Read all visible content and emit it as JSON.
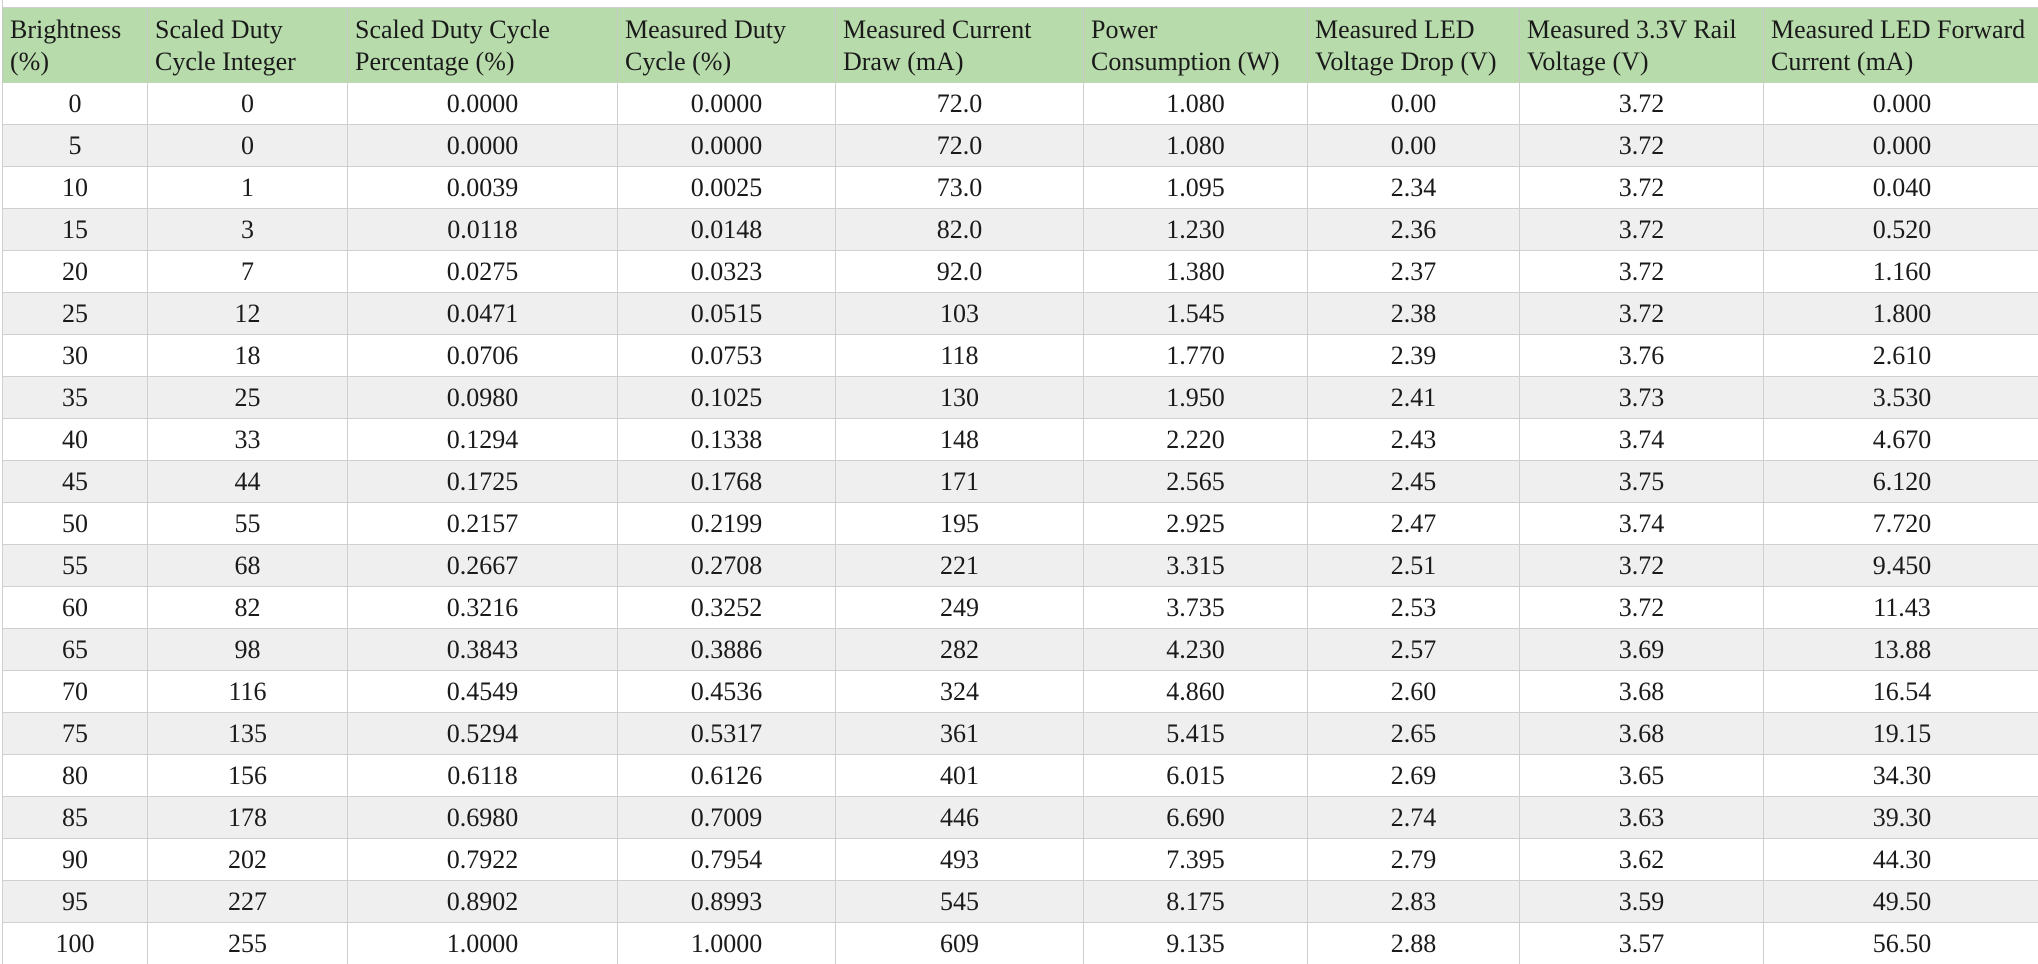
{
  "table": {
    "headers": [
      "Brightness (%)",
      "Scaled Duty Cycle Integer",
      "Scaled Duty Cycle Percentage (%)",
      "Measured Duty Cycle (%)",
      "Measured Current Draw (mA)",
      "Power Consumption (W)",
      "Measured LED Voltage Drop (V)",
      "Measured 3.3V Rail Voltage (V)",
      "Measured LED Forward Current (mA)"
    ],
    "rows": [
      [
        "0",
        "0",
        "0.0000",
        "0.0000",
        "72.0",
        "1.080",
        "0.00",
        "3.72",
        "0.000"
      ],
      [
        "5",
        "0",
        "0.0000",
        "0.0000",
        "72.0",
        "1.080",
        "0.00",
        "3.72",
        "0.000"
      ],
      [
        "10",
        "1",
        "0.0039",
        "0.0025",
        "73.0",
        "1.095",
        "2.34",
        "3.72",
        "0.040"
      ],
      [
        "15",
        "3",
        "0.0118",
        "0.0148",
        "82.0",
        "1.230",
        "2.36",
        "3.72",
        "0.520"
      ],
      [
        "20",
        "7",
        "0.0275",
        "0.0323",
        "92.0",
        "1.380",
        "2.37",
        "3.72",
        "1.160"
      ],
      [
        "25",
        "12",
        "0.0471",
        "0.0515",
        "103",
        "1.545",
        "2.38",
        "3.72",
        "1.800"
      ],
      [
        "30",
        "18",
        "0.0706",
        "0.0753",
        "118",
        "1.770",
        "2.39",
        "3.76",
        "2.610"
      ],
      [
        "35",
        "25",
        "0.0980",
        "0.1025",
        "130",
        "1.950",
        "2.41",
        "3.73",
        "3.530"
      ],
      [
        "40",
        "33",
        "0.1294",
        "0.1338",
        "148",
        "2.220",
        "2.43",
        "3.74",
        "4.670"
      ],
      [
        "45",
        "44",
        "0.1725",
        "0.1768",
        "171",
        "2.565",
        "2.45",
        "3.75",
        "6.120"
      ],
      [
        "50",
        "55",
        "0.2157",
        "0.2199",
        "195",
        "2.925",
        "2.47",
        "3.74",
        "7.720"
      ],
      [
        "55",
        "68",
        "0.2667",
        "0.2708",
        "221",
        "3.315",
        "2.51",
        "3.72",
        "9.450"
      ],
      [
        "60",
        "82",
        "0.3216",
        "0.3252",
        "249",
        "3.735",
        "2.53",
        "3.72",
        "11.43"
      ],
      [
        "65",
        "98",
        "0.3843",
        "0.3886",
        "282",
        "4.230",
        "2.57",
        "3.69",
        "13.88"
      ],
      [
        "70",
        "116",
        "0.4549",
        "0.4536",
        "324",
        "4.860",
        "2.60",
        "3.68",
        "16.54"
      ],
      [
        "75",
        "135",
        "0.5294",
        "0.5317",
        "361",
        "5.415",
        "2.65",
        "3.68",
        "19.15"
      ],
      [
        "80",
        "156",
        "0.6118",
        "0.6126",
        "401",
        "6.015",
        "2.69",
        "3.65",
        "34.30"
      ],
      [
        "85",
        "178",
        "0.6980",
        "0.7009",
        "446",
        "6.690",
        "2.74",
        "3.63",
        "39.30"
      ],
      [
        "90",
        "202",
        "0.7922",
        "0.7954",
        "493",
        "7.395",
        "2.79",
        "3.62",
        "44.30"
      ],
      [
        "95",
        "227",
        "0.8902",
        "0.8993",
        "545",
        "8.175",
        "2.83",
        "3.59",
        "49.50"
      ],
      [
        "100",
        "255",
        "1.0000",
        "1.0000",
        "609",
        "9.135",
        "2.88",
        "3.57",
        "56.50"
      ]
    ]
  },
  "colors": {
    "header_bg": "#b7dbab",
    "stripe_bg": "#efefef",
    "grid": "#cfcfcf"
  }
}
